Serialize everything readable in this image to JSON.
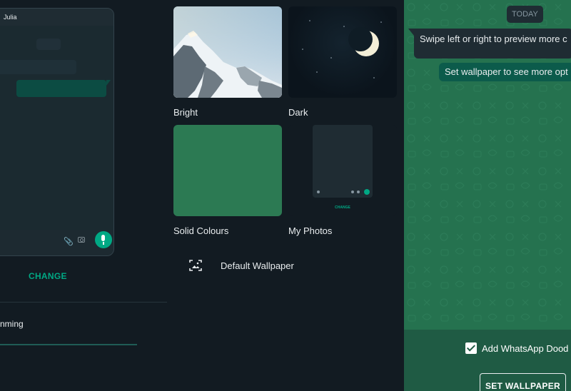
{
  "preview_phone": {
    "contact_name": "Julia"
  },
  "left": {
    "change_label": "CHANGE",
    "dimming_label": "nming",
    "dimming_level": 0
  },
  "categories": [
    {
      "label": "Bright"
    },
    {
      "label": "Dark"
    },
    {
      "label": "Solid Colours"
    },
    {
      "label": "My Photos",
      "thumb_change_label": "CHANGE"
    }
  ],
  "default_wallpaper": {
    "label": "Default Wallpaper",
    "icon": "wallpaper-icon"
  },
  "preview": {
    "date_chip": "TODAY",
    "incoming_message": "Swipe left or right to preview more c",
    "outgoing_message": "Set wallpaper to see more opt",
    "doodles_label": "Add WhatsApp Dood",
    "doodles_checked": true,
    "set_button": "SET WALLPAPER"
  },
  "colors": {
    "accent": "#00a884",
    "background": "#121b22",
    "wallpaper_green": "#25724f",
    "outgoing_bubble": "#0c5b4b",
    "incoming_bubble": "#1f2c33"
  }
}
